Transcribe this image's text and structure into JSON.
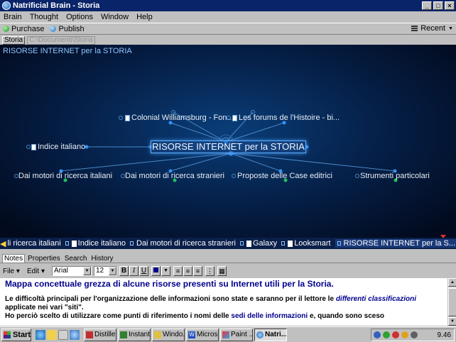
{
  "window": {
    "title": "Natrificial Brain - Storia"
  },
  "menu": [
    "Brain",
    "Thought",
    "Options",
    "Window",
    "Help"
  ],
  "toolbar": {
    "purchase": "Purchase",
    "publish": "Publish",
    "recent": "Recent"
  },
  "path": {
    "tab": "Storia",
    "location": "C:\\Documenti\\Storia"
  },
  "brain": {
    "header": "RISORSE INTERNET per la STORIA",
    "central": "RISORSE INTERNET per la STORIA",
    "jumps": [
      "Colonial Williamsburg - Fon...",
      "Les forums de l'Histoire - bi..."
    ],
    "parent": "Indice italiano",
    "children": [
      "Dai motori di ricerca italiani",
      "Dai motori di ricerca stranieri",
      "Proposte delle Case editrici",
      "Strumenti particolari"
    ]
  },
  "pins": [
    "li ricerca italiani",
    "Indice italiano",
    "Dai motori di ricerca stranieri",
    "Galaxy",
    "Looksmart",
    "RISORSE INTERNET per la S..."
  ],
  "notes_tabs": [
    "Notes",
    "Properties",
    "Search",
    "History"
  ],
  "format": {
    "file": "File",
    "edit": "Edit",
    "font": "Arial",
    "size": "12"
  },
  "notes": {
    "heading": "Mappa concettuale grezza di alcune risorse presenti su Internet utili per la Storia.",
    "p1_a": "Le difficoltà principali per l'organizzazione delle informazioni sono state e saranno per il lettore le ",
    "p1_em": "differenti classificazioni",
    "p1_b": " applicate nei vari \"siti\".",
    "p2_a": "Ho perciò scelto di utilizzare come punti di riferimento i nomi delle ",
    "p2_link": "sedi delle informazioni",
    "p2_b": " e, quando sono sceso"
  },
  "taskbar": {
    "start": "Start",
    "tasks": [
      "Distiller...",
      "Instant...",
      "Windo...",
      "Micros...",
      "Paint ...",
      "Natri..."
    ],
    "clock": "9.46"
  },
  "colors": {
    "title_bar": "#0a246a",
    "brain_bg": "#051e45",
    "link": "#00008b"
  }
}
